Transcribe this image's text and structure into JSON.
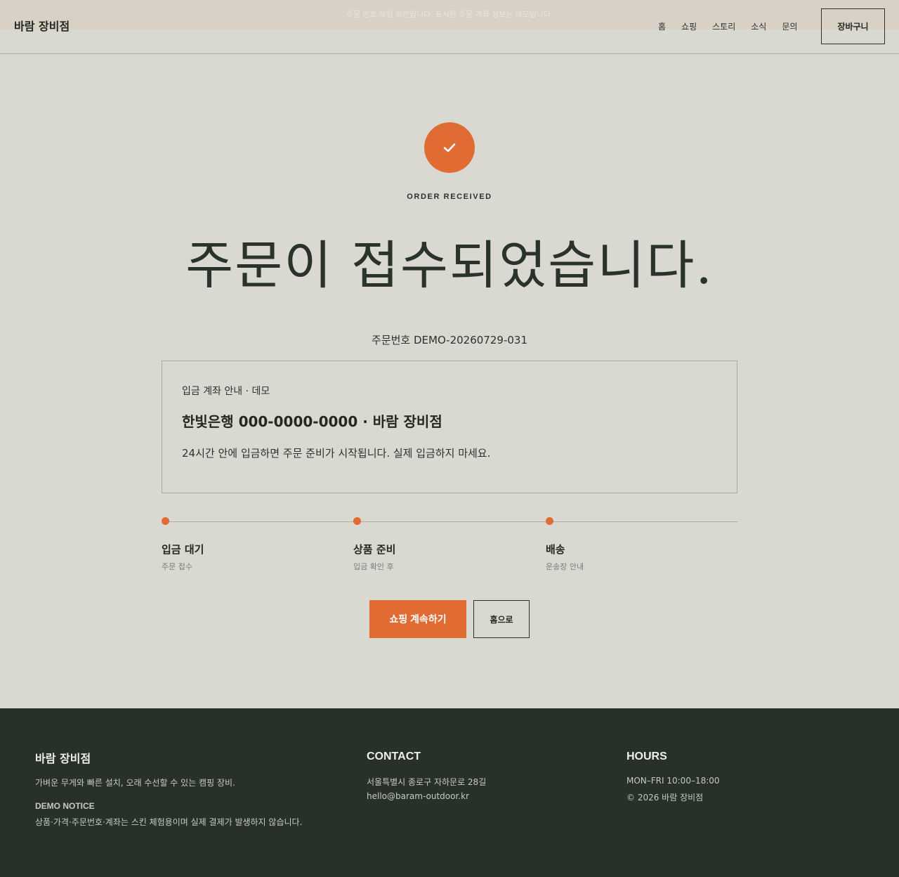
{
  "header": {
    "notice": "주문 번호 체험 화면입니다. 표시된 주문·계좌 정보는 데모입니다.",
    "logo": "바람 장비점",
    "nav": [
      "홈",
      "쇼핑",
      "스토리",
      "소식",
      "문의"
    ],
    "cart_label": "장바구니"
  },
  "main": {
    "check_icon": "check-icon",
    "eyebrow": "ORDER RECEIVED",
    "headline": "주문이 접수되었습니다.",
    "order_number": "주문번호 DEMO-20260729-031",
    "bank": {
      "label": "입금 계좌 안내 · 데모",
      "account": "한빛은행 000-0000-0000 · 바람 장비점",
      "description": "24시간 안에 입금하면 주문 준비가 시작됩니다. 실제 입금하지 마세요."
    },
    "steps": [
      {
        "title": "입금 대기",
        "sub": "주문 접수"
      },
      {
        "title": "상품 준비",
        "sub": "입금 확인 후"
      },
      {
        "title": "배송",
        "sub": "운송장 안내"
      }
    ],
    "continue_label": "쇼핑 계속하기",
    "home_label": "홈으로"
  },
  "footer": {
    "brand": "바람 장비점",
    "tagline": "가벼운 무게와 빠른 설치, 오래 수선할 수 있는 캠핑 장비.",
    "demo_title": "DEMO NOTICE",
    "demo_text": "상품·가격·주문번호·계좌는 스킨 체험용이며 실제 결제가 발생하지 않습니다.",
    "contact_title": "CONTACT",
    "address": "서울특별시 종로구 자하문로 28길",
    "email": "hello@baram-outdoor.kr",
    "hours_title": "HOURS",
    "hours": "MON–FRI 10:00–18:00",
    "copyright": "© 2026 바람 장비점"
  },
  "colors": {
    "accent": "#e06b33",
    "background": "#d9d8d1",
    "footer_bg": "#283129",
    "text": "#263029"
  }
}
